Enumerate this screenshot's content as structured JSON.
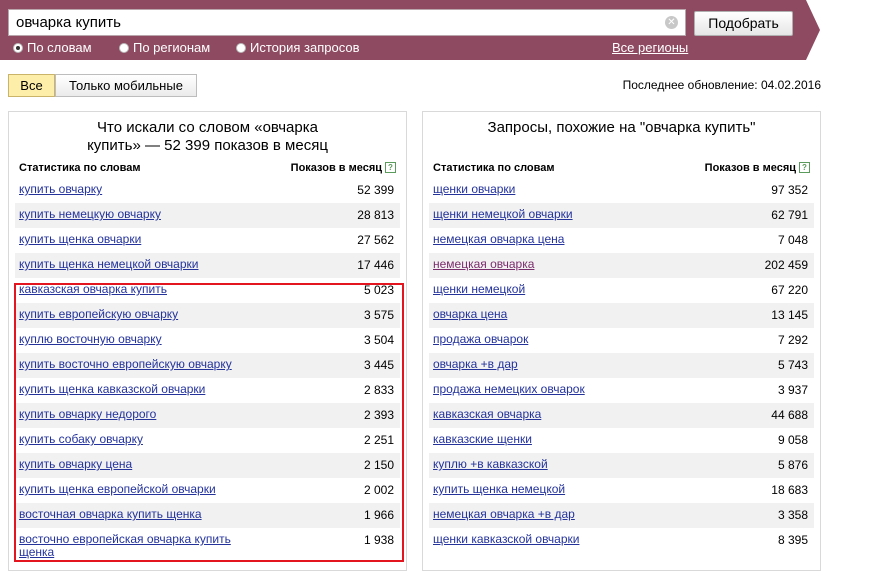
{
  "search": {
    "value": "овчарка купить",
    "clear_icon": "clear-icon",
    "submit_label": "Подобрать"
  },
  "modes": [
    {
      "label": "По словам",
      "selected": true
    },
    {
      "label": "По регионам",
      "selected": false
    },
    {
      "label": "История запросов",
      "selected": false
    }
  ],
  "regions_link": "Все регионы",
  "filter": {
    "all_label": "Все",
    "mobile_label": "Только мобильные"
  },
  "updated_text": "Последнее обновление: 04.02.2016",
  "left_panel": {
    "title_line1": "Что искали со словом «овчарка",
    "title_line2": "купить» — 52 399 показов в месяц",
    "col_words": "Статистика по словам",
    "col_count": "Показов в месяц",
    "rows": [
      {
        "q": "купить овчарку",
        "n": "52 399"
      },
      {
        "q": "купить немецкую овчарку",
        "n": "28 813"
      },
      {
        "q": "купить щенка овчарки",
        "n": "27 562"
      },
      {
        "q": "купить щенка немецкой овчарки",
        "n": "17 446"
      },
      {
        "q": "кавказская овчарка купить",
        "n": "5 023"
      },
      {
        "q": "купить европейскую овчарку",
        "n": "3 575"
      },
      {
        "q": "куплю восточную овчарку",
        "n": "3 504"
      },
      {
        "q": "купить восточно европейскую овчарку",
        "n": "3 445"
      },
      {
        "q": "купить щенка кавказской овчарки",
        "n": "2 833"
      },
      {
        "q": "купить овчарку недорого",
        "n": "2 393"
      },
      {
        "q": "купить собаку овчарку",
        "n": "2 251"
      },
      {
        "q": "купить овчарку цена",
        "n": "2 150"
      },
      {
        "q": "купить щенка европейской овчарки",
        "n": "2 002"
      },
      {
        "q": "восточная овчарка купить щенка",
        "n": "1 966"
      },
      {
        "q": "восточно европейская овчарка купить щенка",
        "n": "1 938"
      }
    ]
  },
  "right_panel": {
    "title": "Запросы, похожие на \"овчарка купить\"",
    "col_words": "Статистика по словам",
    "col_count": "Показов в месяц",
    "rows": [
      {
        "q": "щенки овчарки",
        "n": "97 352"
      },
      {
        "q": "щенки немецкой овчарки",
        "n": "62 791"
      },
      {
        "q": "немецкая овчарка цена",
        "n": "7 048"
      },
      {
        "q": "немецкая овчарка",
        "n": "202 459"
      },
      {
        "q": "щенки немецкой",
        "n": "67 220"
      },
      {
        "q": "овчарка цена",
        "n": "13 145"
      },
      {
        "q": "продажа овчарок",
        "n": "7 292"
      },
      {
        "q": "овчарка +в дар",
        "n": "5 743"
      },
      {
        "q": "продажа немецких овчарок",
        "n": "3 937"
      },
      {
        "q": "кавказская овчарка",
        "n": "44 688"
      },
      {
        "q": "кавказские щенки",
        "n": "9 058"
      },
      {
        "q": "куплю +в кавказской",
        "n": "5 876"
      },
      {
        "q": "купить щенка немецкой",
        "n": "18 683"
      },
      {
        "q": "немецкая овчарка +в дар",
        "n": "3 358"
      },
      {
        "q": "щенки кавказской овчарки",
        "n": "8 395"
      }
    ]
  },
  "colors": {
    "topbar": "#8e4a60",
    "link": "#24339c",
    "visited_link": "#7a2d6c",
    "highlight": "#e3151f",
    "active_filter": "#fdeea9"
  }
}
